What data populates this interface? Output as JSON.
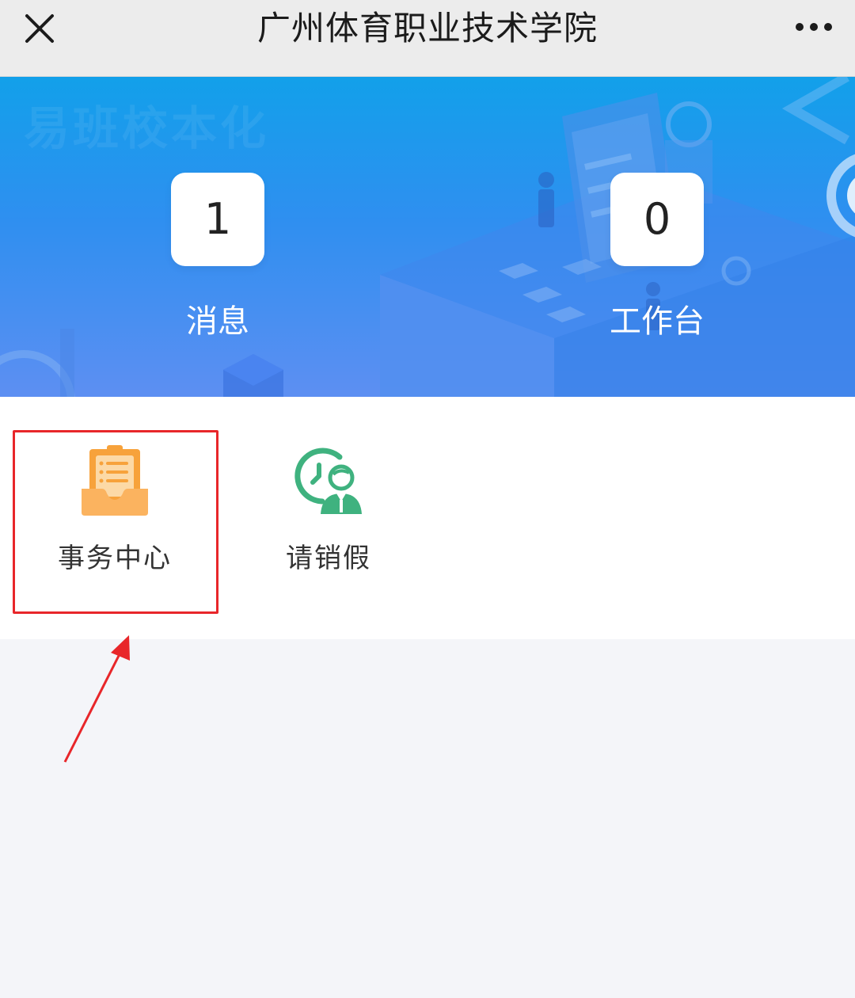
{
  "header": {
    "title": "广州体育职业技术学院",
    "close_icon": "close-icon",
    "more_icon": "more-icon"
  },
  "banner": {
    "watermark": "易班校本化",
    "stats": [
      {
        "value": "1",
        "label": "消息"
      },
      {
        "value": "0",
        "label": "工作台"
      }
    ]
  },
  "apps": [
    {
      "label": "事务中心",
      "icon": "clipboard-tray-icon",
      "color": "#f9a947"
    },
    {
      "label": "请销假",
      "icon": "clock-person-icon",
      "color": "#3fb27f"
    }
  ],
  "annotation": {
    "highlight_color": "#e8262a"
  }
}
